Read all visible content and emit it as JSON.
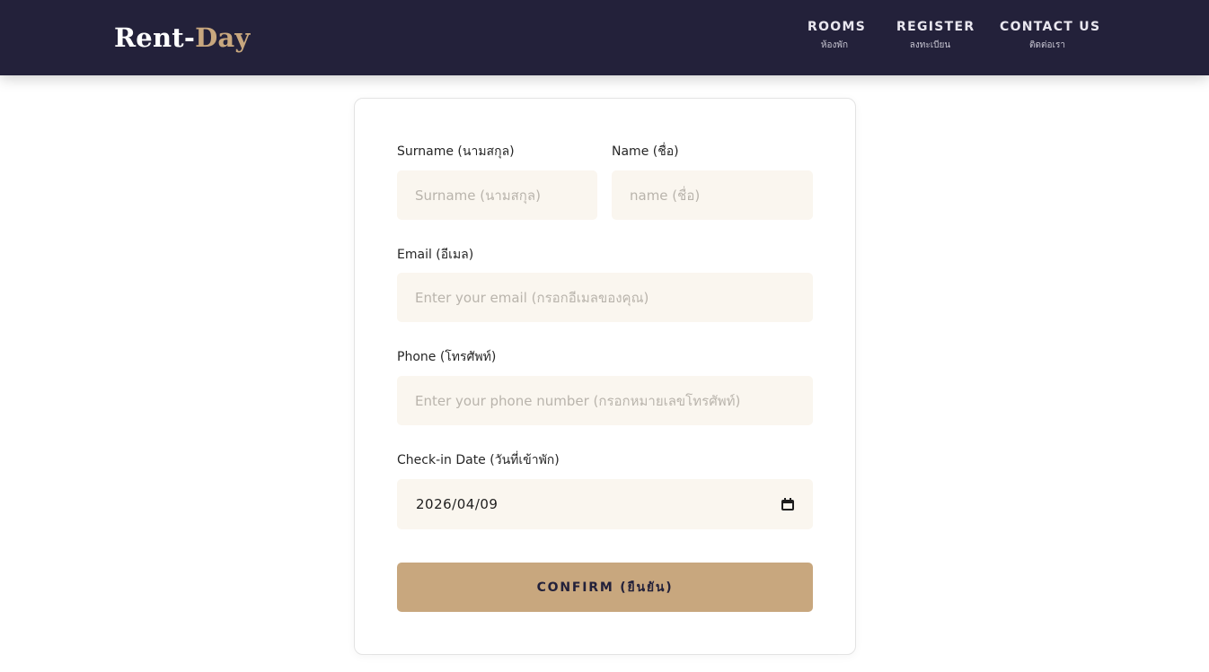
{
  "brand": {
    "part1": "Rent-",
    "part2": "Day"
  },
  "nav": [
    {
      "label": "ROOMS",
      "sub": "ห้องพัก"
    },
    {
      "label": "REGISTER",
      "sub": "ลงทะเบียน"
    },
    {
      "label": "CONTACT US",
      "sub": "ติดต่อเรา"
    }
  ],
  "form": {
    "surname": {
      "label": "Surname (นามสกุล)",
      "placeholder": "Surname (นามสกุล)",
      "value": ""
    },
    "name": {
      "label": "Name (ชื่อ)",
      "placeholder": "name (ชื่อ)",
      "value": ""
    },
    "email": {
      "label": "Email (อีเมล)",
      "placeholder": "Enter your email (กรอกอีเมลของคุณ)",
      "value": ""
    },
    "phone": {
      "label": "Phone (โทรศัพท์)",
      "placeholder": "Enter your phone number (กรอกหมายเลขโทรศัพท์)",
      "value": ""
    },
    "checkin": {
      "label": "Check-in Date (วันที่เข้าพัก)",
      "value": "2026/04/09",
      "icon": "calendar-icon"
    },
    "submit_label": "CONFIRM (ยืนยัน)"
  },
  "colors": {
    "nav_bg": "#23213a",
    "accent": "#c8a77e",
    "field_bg": "#faf6ef"
  }
}
